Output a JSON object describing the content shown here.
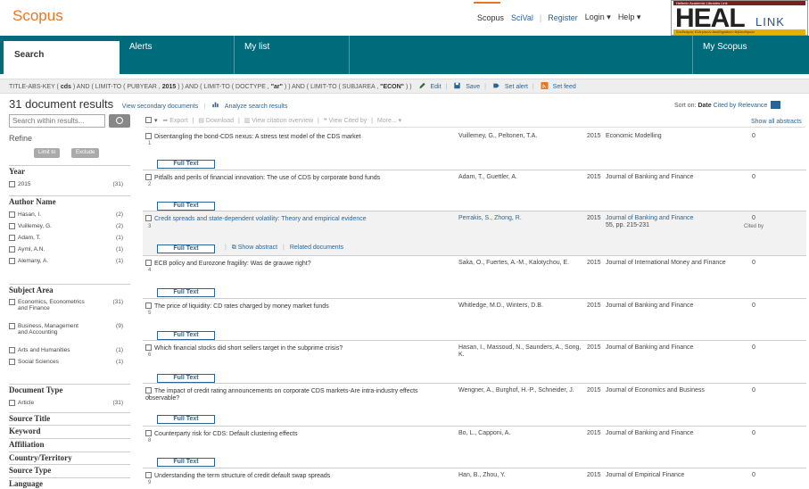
{
  "brand": "Scopus",
  "top_links": {
    "scopus": "Scopus",
    "scival": "SciVal",
    "register": "Register",
    "login": "Login",
    "help": "Help"
  },
  "heal": {
    "top": "Hellenic Academic Libraries Link",
    "big": "HEAL",
    "link": "LINK",
    "bottom": "Σύνδεσμος Ελληνικών Ακαδημαϊκών Βιβλιοθηκών"
  },
  "tabs": {
    "search": "Search",
    "alerts": "Alerts",
    "mylist": "My list",
    "myscopus": "My Scopus"
  },
  "query": {
    "p1": "TITLE-ABS-KEY ( ",
    "k1": "cds",
    "p2": " ) AND ( LIMIT-TO ( PUBYEAR , ",
    "k2": "2015",
    "p3": " ) ) AND ( LIMIT-TO ( DOCTYPE , ",
    "k3": "\"ar\"",
    "p4": " ) ) AND ( LIMIT-TO ( SUBJAREA , ",
    "k4": "\"ECON\"",
    "p5": " ) )",
    "edit": "Edit",
    "save": "Save",
    "alert": "Set alert",
    "feed": "Set feed"
  },
  "results": {
    "count": "31",
    "count_label": "document results",
    "secondary": "View secondary documents",
    "analyze": "Analyze search results"
  },
  "sort": {
    "label": "Sort on:",
    "date": "Date",
    "cited": "Cited by",
    "relevance": "Relevance"
  },
  "show_all": "Show all abstracts",
  "toolbar": {
    "export": "Export",
    "download": "Download",
    "citation": "View citation overview",
    "citedby": "View Cited by",
    "more": "More..."
  },
  "sidebar": {
    "search_placeholder": "Search within results...",
    "refine": "Refine",
    "limit": "Limit to",
    "exclude": "Exclude",
    "year_title": "Year",
    "year": [
      {
        "label": "2015",
        "count": "(31)"
      }
    ],
    "author_title": "Author Name",
    "authors": [
      {
        "label": "Hasan, I.",
        "count": "(2)"
      },
      {
        "label": "Vuillemey, G.",
        "count": "(2)"
      },
      {
        "label": "Adam, T.",
        "count": "(1)"
      },
      {
        "label": "Ayml, A.N.",
        "count": "(1)"
      },
      {
        "label": "Alemany, A.",
        "count": "(1)"
      }
    ],
    "subject_title": "Subject Area",
    "subjects": [
      {
        "label": "Economics, Econometrics and Finance",
        "count": "(31)"
      },
      {
        "label": "Business, Management and Accounting",
        "count": "(9)"
      },
      {
        "label": "Arts and Humanities",
        "count": "(1)"
      },
      {
        "label": "Social Sciences",
        "count": "(1)"
      }
    ],
    "doctype_title": "Document Type",
    "doctypes": [
      {
        "label": "Article",
        "count": "(31)"
      }
    ],
    "more_sections": [
      "Source Title",
      "Keyword",
      "Affiliation",
      "Country/Territory",
      "Source Type",
      "Language"
    ]
  },
  "full_text": "Full Text",
  "show_abstract": "Show abstract",
  "related": "Related documents",
  "cited_by": "Cited by",
  "rows": [
    {
      "num": "1",
      "title": "Disentangling the bond-CDS nexus: A stress test model of the CDS market",
      "authors": "Vuillemey, G., Peltonen, T.A.",
      "year": "2015",
      "source": "Economic Modelling",
      "cited": "0"
    },
    {
      "num": "2",
      "title": "Pitfalls and perils of financial innovation: The use of CDS by corporate bond funds",
      "authors": "Adam, T., Guettler, A.",
      "year": "2015",
      "source": "Journal of Banking and Finance",
      "cited": "0"
    },
    {
      "num": "3",
      "title": "Credit spreads and state-dependent volatility: Theory and empirical evidence",
      "authors": "Perrakis, S., Zhong, R.",
      "year": "2015",
      "source": "Journal of Banking and Finance",
      "source2": "55, pp. 215-231",
      "cited": "0"
    },
    {
      "num": "4",
      "title": "ECB policy and Eurozone fragility: Was de grauwe right?",
      "authors": "Saka, O., Fuertes, A.-M., Kalotychou, E.",
      "year": "2015",
      "source": "Journal of International Money and Finance",
      "cited": "0"
    },
    {
      "num": "5",
      "title": "The price of liquidity: CD rates charged by money market funds",
      "authors": "Whitledge, M.D., Winters, D.B.",
      "year": "2015",
      "source": "Journal of Banking and Finance",
      "cited": "0"
    },
    {
      "num": "6",
      "title": "Which financial stocks did short sellers target in the subprime crisis?",
      "authors": "Hasan, I., Massoud, N., Saunders, A., Song, K.",
      "year": "2015",
      "source": "Journal of Banking and Finance",
      "cited": "0"
    },
    {
      "num": "7",
      "title": "The impact of credit rating announcements on corporate CDS markets-Are intra-industry effects observable?",
      "authors": "Wengner, A., Burghof, H.-P., Schneider, J.",
      "year": "2015",
      "source": "Journal of Economics and Business",
      "cited": "0"
    },
    {
      "num": "8",
      "title": "Counterparty risk for CDS: Default clustering effects",
      "authors": "Bo, L., Capponi, A.",
      "year": "2015",
      "source": "Journal of Banking and Finance",
      "cited": "0"
    },
    {
      "num": "9",
      "title": "Understanding the term structure of credit default swap spreads",
      "authors": "Han, B., Zhou, Y.",
      "year": "2015",
      "source": "Journal of Empirical Finance",
      "cited": "0"
    }
  ]
}
